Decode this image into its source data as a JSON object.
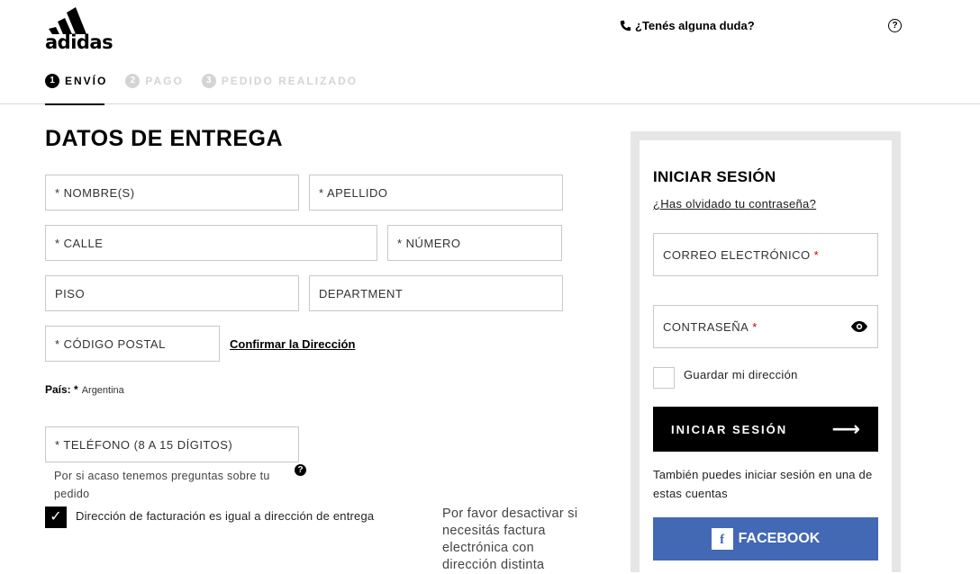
{
  "header": {
    "logo_text": "adidas",
    "help_link": "¿Tenés alguna duda?",
    "help_icon": "?"
  },
  "steps": [
    {
      "number": "1",
      "label": "ENVÍO",
      "active": true
    },
    {
      "number": "2",
      "label": "PAGO",
      "active": false
    },
    {
      "number": "3",
      "label": "PEDIDO REALIZADO",
      "active": false
    }
  ],
  "delivery": {
    "title": "DATOS DE ENTREGA",
    "fields": {
      "first_name": "* NOMBRE(S)",
      "last_name": "* APELLIDO",
      "street": "* CALLE",
      "number": "* NÚMERO",
      "floor": "PISO",
      "apartment": "DEPARTMENT",
      "postal_code": "* CÓDIGO POSTAL",
      "phone": "* TELÉFONO (8 A 15 DÍGITOS)"
    },
    "confirm_address": "Confirmar la Dirección",
    "country_label": "País: *",
    "country_value": "Argentina",
    "phone_help": "Por si acaso tenemos preguntas sobre tu pedido",
    "billing_same_label": "Dirección de facturación es igual a dirección de entrega",
    "billing_same_checked": true,
    "einvoice_note": "Por favor desactivar si necesitás factura electrónica con dirección distinta"
  },
  "login": {
    "title": "INICIAR SESIÓN",
    "forgot_password": "¿Has olvidado tu contraseña?",
    "email_label": "CORREO ELECTRÓNICO",
    "password_label": "CONTRASEÑA",
    "required_mark": "*",
    "save_address_label": "Guardar mi dirección",
    "submit_label": "INICIAR SESIÓN",
    "submit_arrow": "⟶",
    "social_text": "También puedes iniciar sesión en una de estas cuentas",
    "facebook_label": "FACEBOOK",
    "facebook_icon": "f"
  },
  "colors": {
    "facebook_blue": "#4368b4",
    "panel_border": "#e6e6e6",
    "inactive_step": "#d4d4d4"
  }
}
